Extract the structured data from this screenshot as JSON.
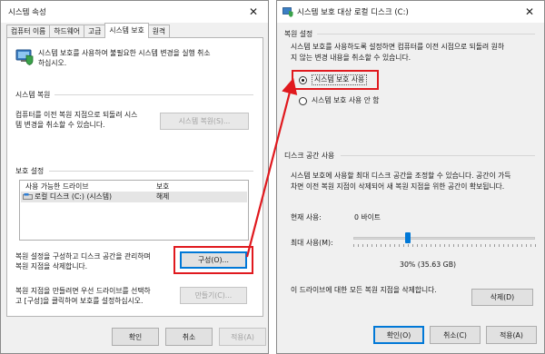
{
  "left_window": {
    "title": "시스템 속성",
    "tabs": [
      "컴퓨터 이름",
      "하드웨어",
      "고급",
      "시스템 보호",
      "원격"
    ],
    "active_tab_index": 3,
    "intro_lines": [
      "시스템 보호를 사용하여 불필요한 시스템 변경을 실행 취소",
      "하십시오."
    ],
    "restore_section_title": "시스템 복원",
    "restore_desc_lines": [
      "컴퓨터를 이전 복원 지점으로 되돌려 시스",
      "템 변경을 취소할 수 있습니다."
    ],
    "restore_button": "시스템 복원(S)...",
    "protection_section_title": "보호 설정",
    "drive_table": {
      "headers": [
        "사용 가능한 드라이브",
        "보호"
      ],
      "rows": [
        {
          "drive": "로컬 디스크 (C:) (시스템)",
          "protection": "해제"
        }
      ]
    },
    "configure_desc_lines": [
      "복원 설정을 구성하고 디스크 공간을 관리하며",
      "복원 지점을 삭제합니다."
    ],
    "configure_button": "구성(O)...",
    "create_desc_lines": [
      "복원 지점을 만들려면 우선 드라이브를 선택하",
      "고 [구성]을 클릭하여 보호를 설정하십시오."
    ],
    "create_button": "만들기(C)...",
    "footer_buttons": {
      "ok": "확인",
      "cancel": "취소",
      "apply": "적용(A)"
    }
  },
  "right_window": {
    "title": "시스템 보호 대상 로컬 디스크 (C:)",
    "restore_settings_title": "복원 설정",
    "restore_settings_desc_lines": [
      "시스템 보호를 사용하도록 설정하면 컴퓨터를 이전 시점으로 되돌려 원하",
      "지 않는 변경 내용을 취소할 수 있습니다."
    ],
    "radio_on": "시스템 보호 사용",
    "radio_off": "시스템 보호 사용 안 함",
    "selected_option": "시스템 보호 사용",
    "disk_section_title": "디스크 공간 사용",
    "disk_desc_lines": [
      "시스템 보호에 사용할 최대 디스크 공간을 조정할 수 있습니다. 공간이 가득",
      "차면 이전 복원 지점이 삭제되어 새 복원 지점을 위한 공간이 확보됩니다."
    ],
    "current_usage_label": "현재 사용:",
    "current_usage_value": "0 바이트",
    "max_usage_label": "최대 사용(M):",
    "slider_fraction": 0.3,
    "max_usage_value": "30% (35.63 GB)",
    "delete_desc": "이 드라이브에 대한 모든 복원 지점을 삭제합니다.",
    "delete_button": "삭제(D)",
    "footer_buttons": {
      "ok": "확인(O)",
      "cancel": "취소(C)",
      "apply": "적용(A)"
    }
  },
  "colors": {
    "highlight": "#e0191e",
    "arrow": "#e0191e",
    "focus": "#0078d7"
  }
}
